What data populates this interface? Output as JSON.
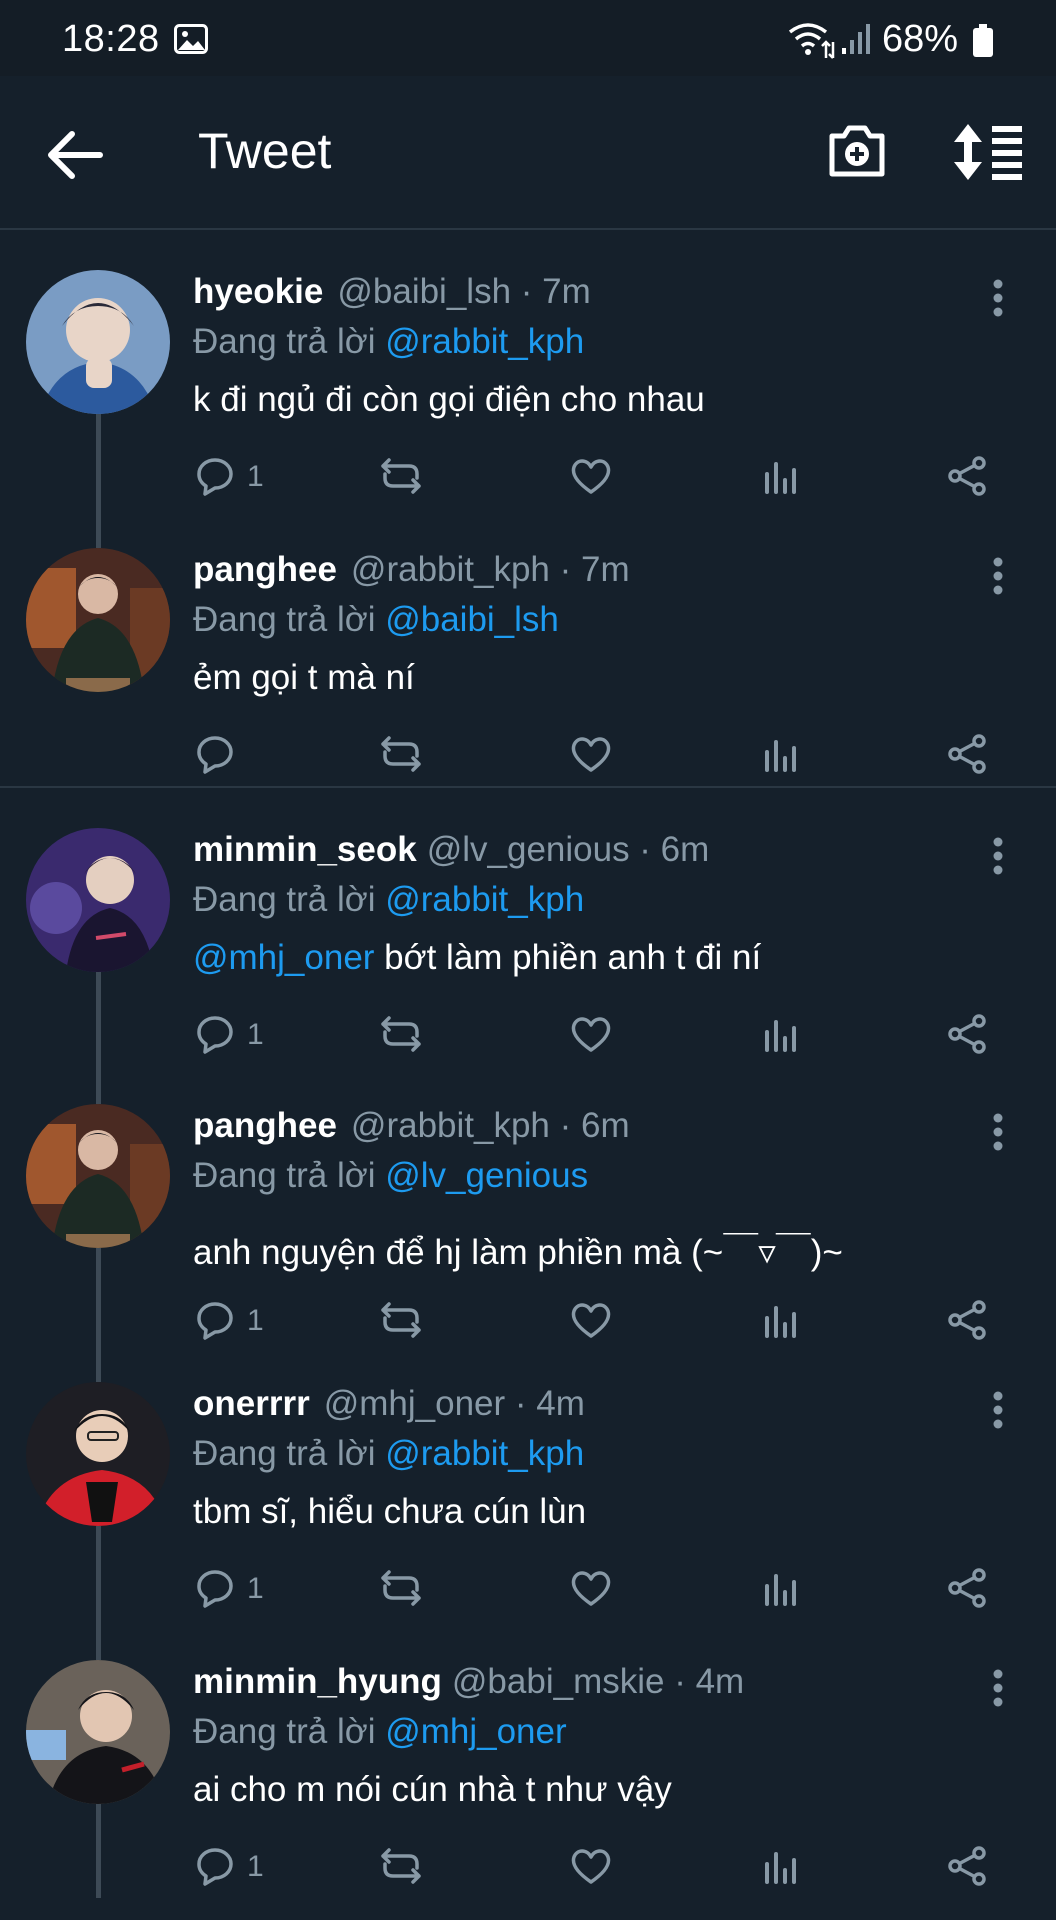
{
  "status_bar": {
    "time": "18:28",
    "battery": "68%",
    "icons": [
      "gallery-icon",
      "wifi-icon",
      "signal-icon",
      "battery-icon"
    ]
  },
  "header": {
    "title": "Tweet",
    "icons": [
      "back-arrow-icon",
      "camera-add-icon",
      "sort-icon"
    ]
  },
  "tweets": [
    {
      "name": "hyeokie",
      "handle": "@baibi_lsh · 7m",
      "reply_prefix": "Đang trả lời",
      "reply_to": "@rabbit_kph",
      "text_mention": "",
      "text": "k đi ngủ đi còn gọi điện cho nhau",
      "reply_count": "1"
    },
    {
      "name": "panghee",
      "handle": "@rabbit_kph · 7m",
      "reply_prefix": "Đang trả lời",
      "reply_to": "@baibi_lsh",
      "text_mention": "",
      "text": "ẻm gọi t mà ní",
      "reply_count": ""
    },
    {
      "name": "minmin_seok",
      "handle": "@lv_genious · 6m",
      "reply_prefix": "Đang trả lời",
      "reply_to": "@rabbit_kph",
      "text_mention": "@mhj_oner",
      "text": " bớt làm phiền anh t đi ní",
      "reply_count": "1"
    },
    {
      "name": "panghee",
      "handle": "@rabbit_kph · 6m",
      "reply_prefix": "Đang trả lời",
      "reply_to": "@lv_genious",
      "text_mention": "",
      "text": "anh nguyện để hj làm phiền mà (~￣▿￣)~",
      "reply_count": "1"
    },
    {
      "name": "onerrrr",
      "handle": "@mhj_oner · 4m",
      "reply_prefix": "Đang trả lời",
      "reply_to": "@rabbit_kph",
      "text_mention": "",
      "text": "tbm sĩ, hiểu chưa cún lùn",
      "reply_count": "1"
    },
    {
      "name": "minmin_hyung",
      "handle": "@babi_mskie · 4m",
      "reply_prefix": "Đang trả lời",
      "reply_to": "@mhj_oner",
      "text_mention": "",
      "text": "ai cho m nói cún nhà t như vậy",
      "reply_count": "1"
    }
  ],
  "colors": {
    "background": "#15202b",
    "accent": "#1d9bf0",
    "muted": "#8899a6"
  }
}
